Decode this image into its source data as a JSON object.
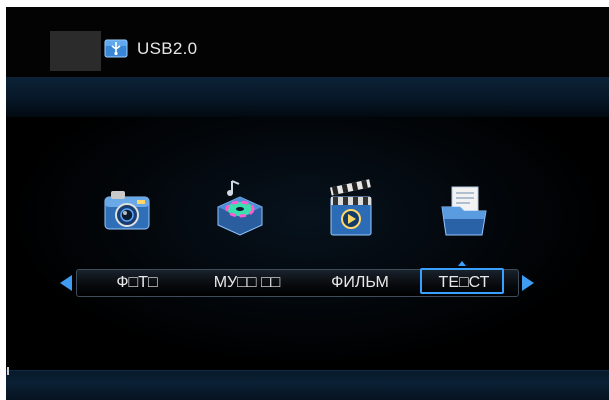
{
  "header": {
    "device_label": "USB2.0",
    "device_icon": "usb-drive-icon"
  },
  "menu": {
    "items": [
      {
        "label": "Ф□Т□",
        "icon": "camera-icon"
      },
      {
        "label": "МУ□□ □□",
        "icon": "music-speaker-icon"
      },
      {
        "label": "ФИЛЬМ",
        "icon": "clapperboard-icon"
      },
      {
        "label": "ТЕ□СТ",
        "icon": "document-folder-icon"
      }
    ],
    "selected_index": 3,
    "nav_left_icon": "arrow-left-icon",
    "nav_right_icon": "arrow-right-icon"
  },
  "colors": {
    "background": "#000000",
    "accent": "#38a0ff",
    "text": "#e8e8e8",
    "band": "#0a1f33"
  }
}
